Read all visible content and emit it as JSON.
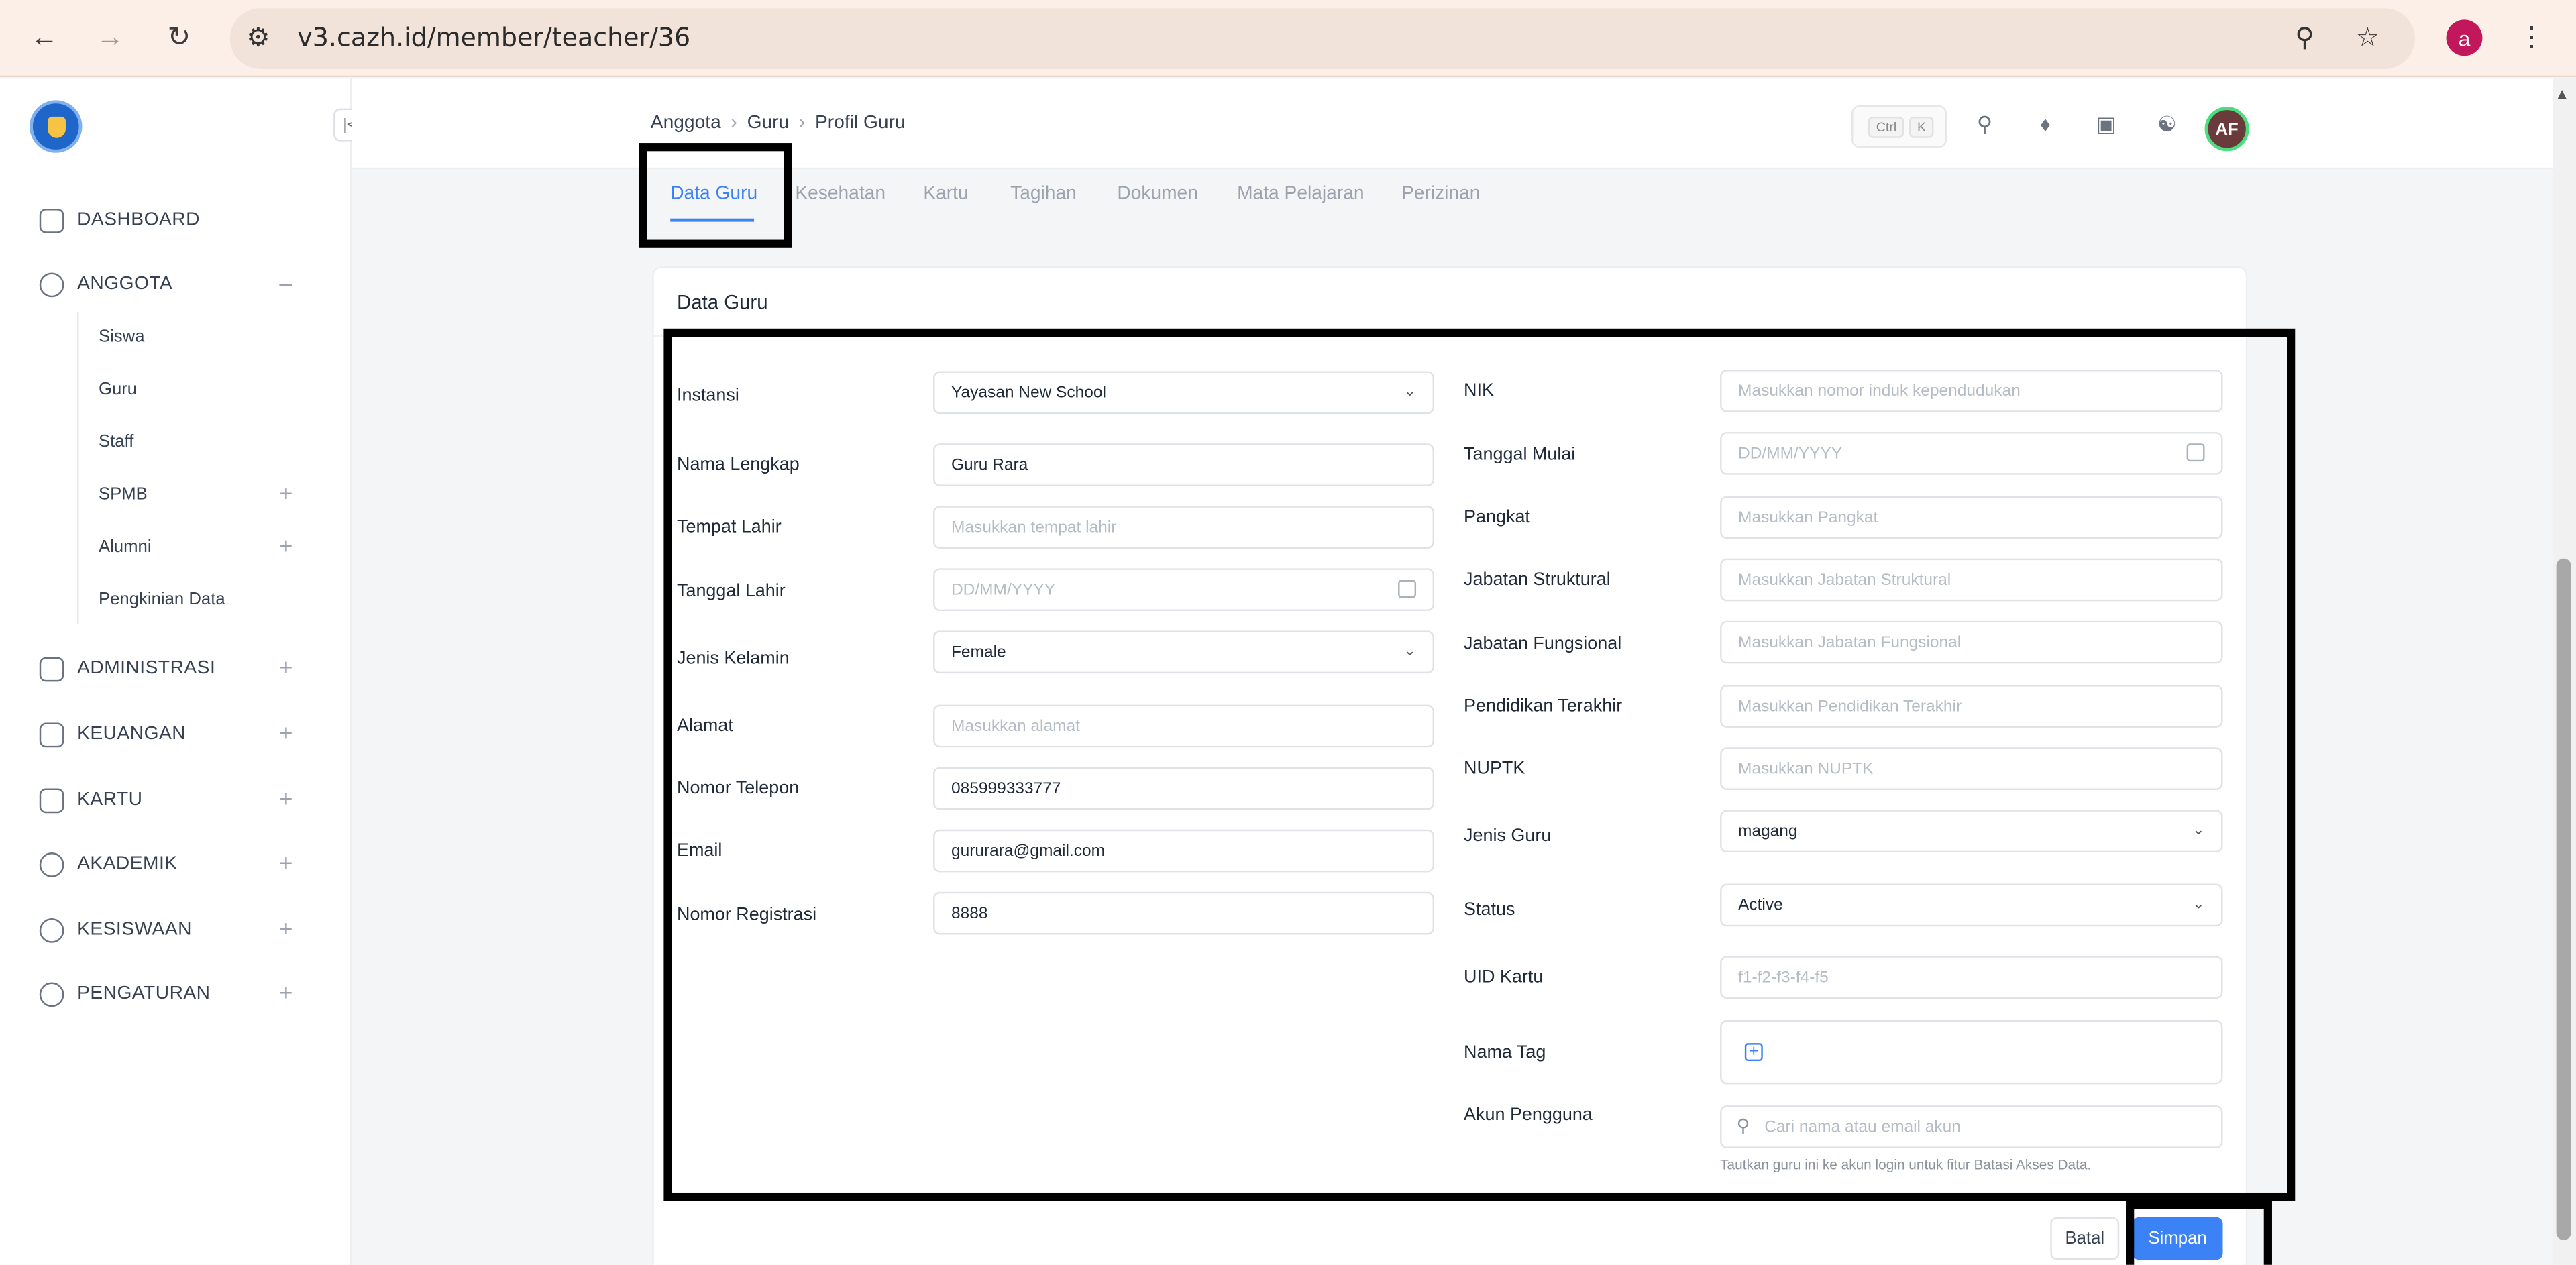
{
  "browser": {
    "url": "v3.cazh.id/member/teacher/36",
    "profile_initial": "a",
    "icons": [
      "back-arrow-icon",
      "forward-arrow-icon",
      "reload-icon",
      "site-settings-icon",
      "zoom-icon",
      "bookmark-star-icon",
      "kebab-menu-icon"
    ]
  },
  "sidebar": {
    "nav": [
      {
        "label": "DASHBOARD",
        "icon": "grid-icon",
        "expandable": false
      },
      {
        "label": "ANGGOTA",
        "icon": "users-icon",
        "expandable": true,
        "expanded": true
      },
      {
        "label": "ADMINISTRASI",
        "icon": "folder-icon",
        "expandable": true
      },
      {
        "label": "KEUANGAN",
        "icon": "money-icon",
        "expandable": true
      },
      {
        "label": "KARTU",
        "icon": "card-icon",
        "expandable": true
      },
      {
        "label": "AKADEMIK",
        "icon": "academic-icon",
        "expandable": true
      },
      {
        "label": "KESISWAAN",
        "icon": "badge-icon",
        "expandable": true
      },
      {
        "label": "PENGATURAN",
        "icon": "gear-icon",
        "expandable": true
      }
    ],
    "anggota_sub": [
      "Siswa",
      "Guru",
      "Staff",
      "SPMB",
      "Alumni",
      "Pengkinian Data"
    ],
    "expand_symbol": "+",
    "collapse_symbol": "–"
  },
  "header": {
    "breadcrumb": [
      "Anggota",
      "Guru",
      "Profil Guru"
    ],
    "shortcut_keys": [
      "Ctrl",
      "K"
    ],
    "user_initials": "AF"
  },
  "tabs": [
    "Data Guru",
    "Kesehatan",
    "Kartu",
    "Tagihan",
    "Dokumen",
    "Mata Pelajaran",
    "Perizinan"
  ],
  "form": {
    "title": "Data Guru",
    "left": [
      {
        "label": "Instansi",
        "value": "Yayasan New School",
        "placeholder": "",
        "type": "select"
      },
      {
        "label": "Nama Lengkap",
        "value": "Guru Rara",
        "placeholder": "",
        "type": "text"
      },
      {
        "label": "Tempat Lahir",
        "value": "",
        "placeholder": "Masukkan tempat lahir",
        "type": "text"
      },
      {
        "label": "Tanggal Lahir",
        "value": "",
        "placeholder": "DD/MM/YYYY",
        "type": "date"
      },
      {
        "label": "Jenis Kelamin",
        "value": "Female",
        "placeholder": "",
        "type": "select"
      },
      {
        "label": "Alamat",
        "value": "",
        "placeholder": "Masukkan alamat",
        "type": "text"
      },
      {
        "label": "Nomor Telepon",
        "value": "085999333777",
        "placeholder": "",
        "type": "text"
      },
      {
        "label": "Email",
        "value": "gururara@gmail.com",
        "placeholder": "",
        "type": "text"
      },
      {
        "label": "Nomor Registrasi",
        "value": "8888",
        "placeholder": "",
        "type": "text"
      }
    ],
    "right": [
      {
        "label": "NIK",
        "value": "",
        "placeholder": "Masukkan nomor induk kependudukan",
        "type": "text"
      },
      {
        "label": "Tanggal Mulai",
        "value": "",
        "placeholder": "DD/MM/YYYY",
        "type": "date"
      },
      {
        "label": "Pangkat",
        "value": "",
        "placeholder": "Masukkan Pangkat",
        "type": "text"
      },
      {
        "label": "Jabatan Struktural",
        "value": "",
        "placeholder": "Masukkan Jabatan Struktural",
        "type": "text"
      },
      {
        "label": "Jabatan Fungsional",
        "value": "",
        "placeholder": "Masukkan Jabatan Fungsional",
        "type": "text"
      },
      {
        "label": "Pendidikan Terakhir",
        "value": "",
        "placeholder": "Masukkan Pendidikan Terakhir",
        "type": "text"
      },
      {
        "label": "NUPTK",
        "value": "",
        "placeholder": "Masukkan NUPTK",
        "type": "text"
      },
      {
        "label": "Jenis Guru",
        "value": "magang",
        "placeholder": "",
        "type": "select"
      },
      {
        "label": "Status",
        "value": "Active",
        "placeholder": "",
        "type": "select"
      },
      {
        "label": "UID Kartu",
        "value": "",
        "placeholder": "f1-f2-f3-f4-f5",
        "type": "text"
      }
    ],
    "nama_tag_label": "Nama Tag",
    "akun_label": "Akun Pengguna",
    "akun_placeholder": "Cari nama atau email akun",
    "akun_hint": "Tautkan guru ini ke akun login untuk fitur Batasi Akses Data.",
    "cancel_label": "Batal",
    "save_label": "Simpan"
  },
  "colors": {
    "accent": "#3b82f6",
    "highlight": "#000000",
    "browser_bar": "#fcefe8"
  }
}
